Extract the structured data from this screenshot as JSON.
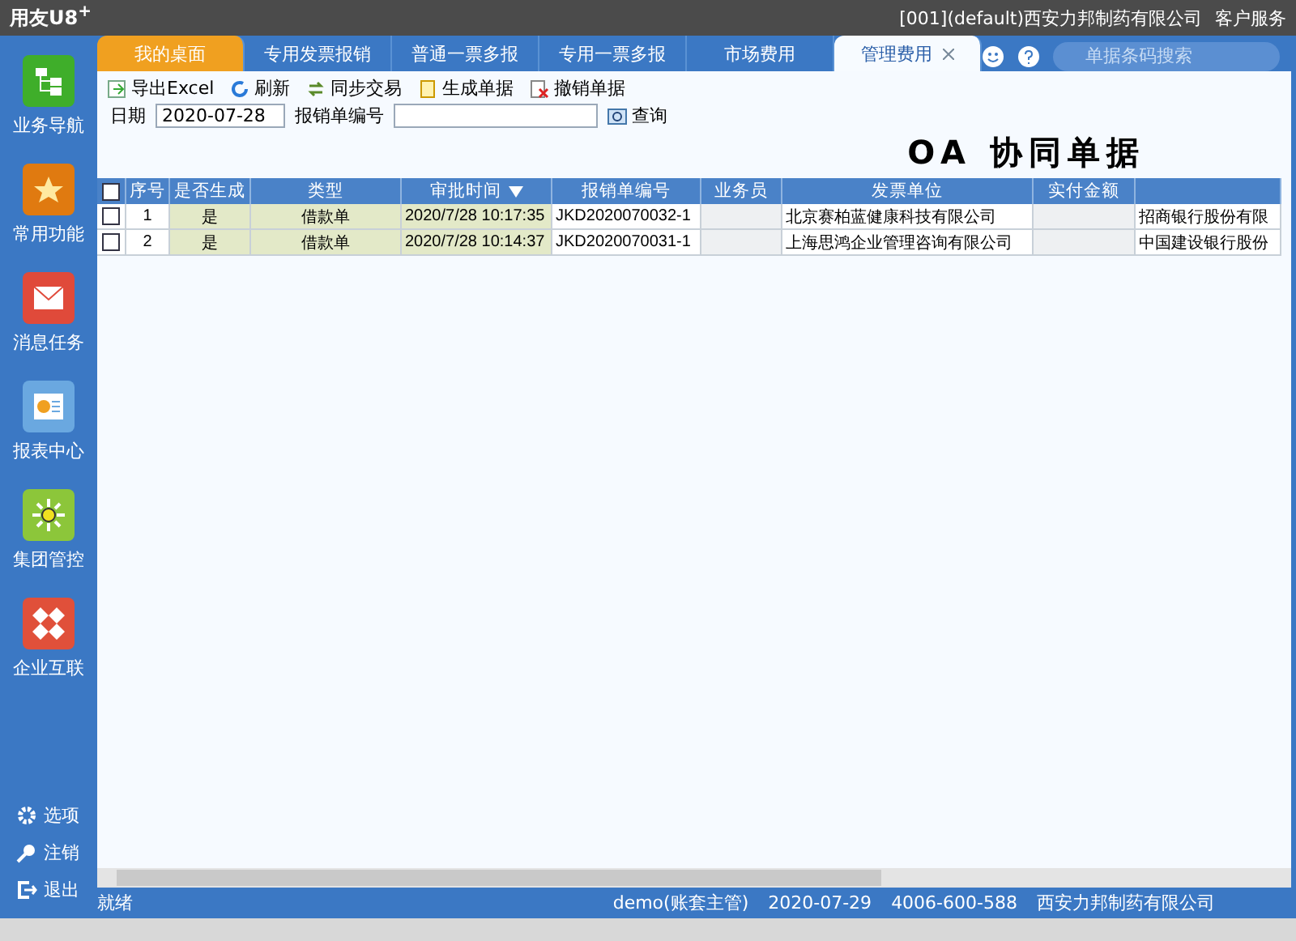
{
  "titlebar": {
    "logo": "用友U8",
    "logo_sup": "+",
    "account": "[001](default)西安力邦制药有限公司",
    "service": "客户服务"
  },
  "sidebar": {
    "items": [
      {
        "label": "业务导航",
        "kind": "tree",
        "color": "#3fae2a"
      },
      {
        "label": "常用功能",
        "kind": "star",
        "color": "#e07a10"
      },
      {
        "label": "消息任务",
        "kind": "mail",
        "color": "#e04a3a"
      },
      {
        "label": "报表中心",
        "kind": "report",
        "color": "#6aa8e0"
      },
      {
        "label": "集团管控",
        "kind": "sun",
        "color": "#8cc63a"
      },
      {
        "label": "企业互联",
        "kind": "link",
        "color": "#e0503a"
      }
    ],
    "bottom": [
      {
        "label": "选项",
        "kind": "gear"
      },
      {
        "label": "注销",
        "kind": "key"
      },
      {
        "label": "退出",
        "kind": "exit"
      }
    ]
  },
  "tabs": [
    {
      "label": "我的桌面",
      "selected": false,
      "kind": "home"
    },
    {
      "label": "专用发票报销",
      "selected": false,
      "kind": "tab"
    },
    {
      "label": "普通一票多报",
      "selected": false,
      "kind": "tab"
    },
    {
      "label": "专用一票多报",
      "selected": false,
      "kind": "tab"
    },
    {
      "label": "市场费用",
      "selected": false,
      "kind": "tab"
    },
    {
      "label": "管理费用",
      "selected": true,
      "kind": "tab"
    }
  ],
  "search": {
    "placeholder": "单据条码搜索"
  },
  "toolbar": [
    {
      "label": "导出Excel",
      "kind": "excel"
    },
    {
      "label": "刷新",
      "kind": "refresh"
    },
    {
      "label": "同步交易",
      "kind": "sync"
    },
    {
      "label": "生成单据",
      "kind": "doc"
    },
    {
      "label": "撤销单据",
      "kind": "cancel"
    }
  ],
  "filters": {
    "date_label": "日期",
    "date_value": "2020-07-28",
    "number_label": "报销单编号",
    "query": "查询"
  },
  "heading": "OA 协同单据",
  "table": {
    "all_checked": false,
    "columns": [
      "序号",
      "是否生成",
      "类型",
      "审批时间",
      "报销单编号",
      "业务员",
      "发票单位",
      "实付金额"
    ],
    "rows": [
      {
        "checked": false,
        "cells": [
          "1",
          "是",
          "借款单",
          "2020/7/28 10:17:35",
          "JKD2020070032-1",
          "",
          "北京赛柏蓝健康科技有限公司",
          "",
          "招商银行股份有限"
        ]
      },
      {
        "checked": false,
        "cells": [
          "2",
          "是",
          "借款单",
          "2020/7/28 10:14:37",
          "JKD2020070031-1",
          "",
          "上海思鸿企业管理咨询有限公司",
          "",
          "中国建设银行股份"
        ]
      }
    ]
  },
  "status_bar": {
    "state": "就绪",
    "user": "demo(账套主管)",
    "date": "2020-07-29",
    "phone": "4006-600-588",
    "company": "西安力邦制药有限公司"
  }
}
